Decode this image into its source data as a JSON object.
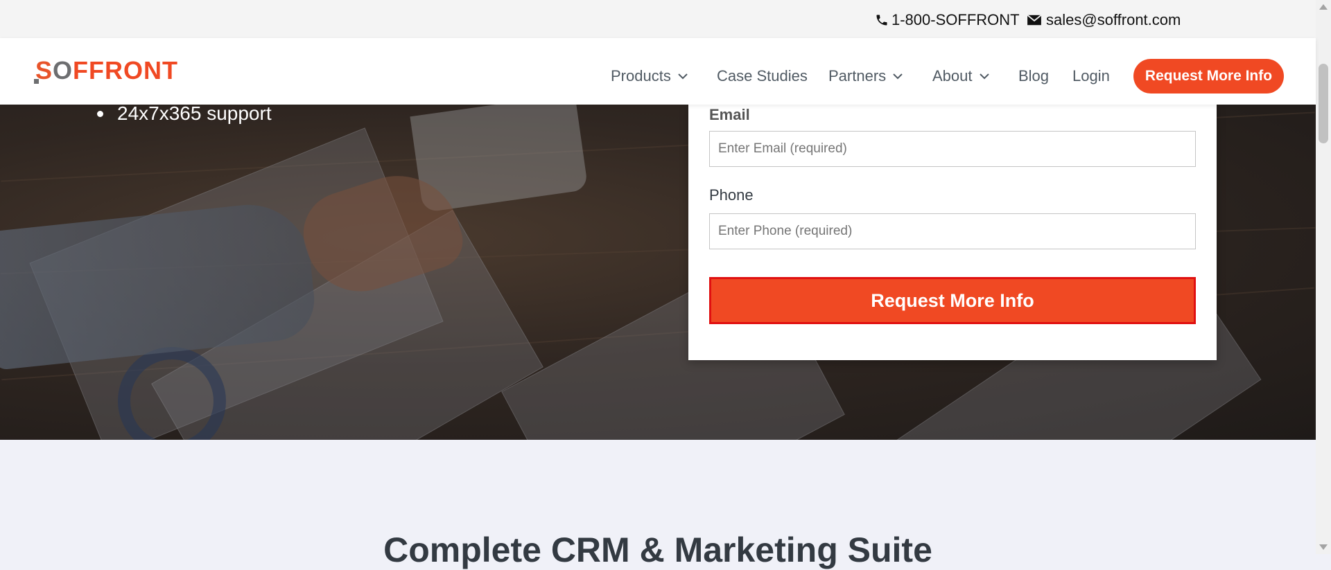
{
  "topbar": {
    "phone": "1-800-SOFFRONT",
    "email": "sales@soffront.com",
    "phone_icon": "phone-icon",
    "email_icon": "envelope-icon"
  },
  "header": {
    "logo_s": "S",
    "logo_so": "O",
    "logo_front": "FFRONT",
    "nav": {
      "products": "Products",
      "case_studies": "Case Studies",
      "partners": "Partners",
      "about": "About",
      "blog": "Blog",
      "login": "Login"
    },
    "cta": "Request More Info"
  },
  "hero": {
    "bullet": "24x7x365 support"
  },
  "form": {
    "email_label": "Email",
    "email_placeholder": "Enter Email (required)",
    "phone_label": "Phone",
    "phone_placeholder": "Enter Phone (required)",
    "submit_label": "Request More Info"
  },
  "section": {
    "title": "Complete CRM & Marketing Suite"
  },
  "colors": {
    "accent": "#f04923",
    "submit_border": "#e01010",
    "logo_gray": "#6d6e70"
  }
}
